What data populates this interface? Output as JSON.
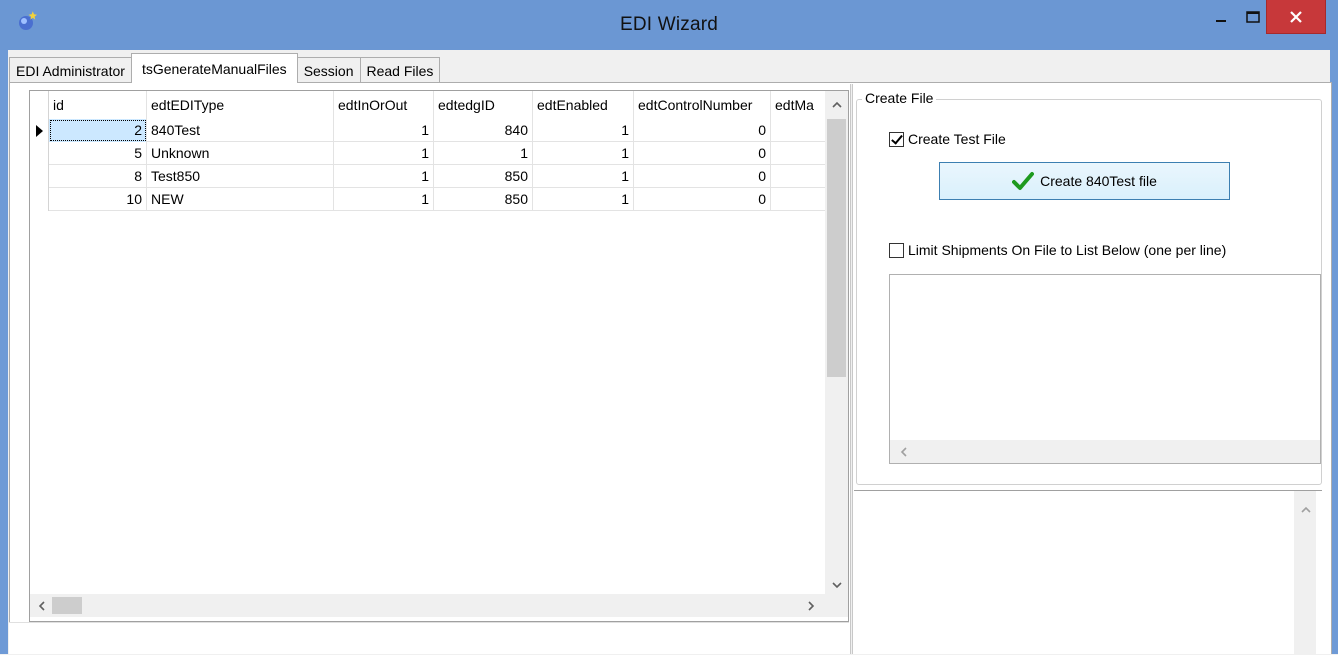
{
  "window": {
    "title": "EDI Wizard",
    "minimize_glyph": "–",
    "maximize_glyph": "☐",
    "close_glyph": "✕",
    "accent": "#6b97d3",
    "close_color": "#c7383a"
  },
  "tabs": [
    {
      "label": "EDI Administrator",
      "active": false
    },
    {
      "label": "tsGenerateManualFiles",
      "active": true
    },
    {
      "label": "Session",
      "active": false
    },
    {
      "label": "Read Files",
      "active": false
    }
  ],
  "grid": {
    "columns": [
      "id",
      "edtEDIType",
      "edtInOrOut",
      "edtedgID",
      "edtEnabled",
      "edtControlNumber",
      "edtMa"
    ],
    "rows": [
      {
        "id": "2",
        "type": "840Test",
        "inout": "1",
        "dgid": "840",
        "enabled": "1",
        "control": "0"
      },
      {
        "id": "5",
        "type": "Unknown",
        "inout": "1",
        "dgid": "1",
        "enabled": "1",
        "control": "0"
      },
      {
        "id": "8",
        "type": "Test850",
        "inout": "1",
        "dgid": "850",
        "enabled": "1",
        "control": "0"
      },
      {
        "id": "10",
        "type": "NEW",
        "inout": "1",
        "dgid": "850",
        "enabled": "1",
        "control": "0"
      }
    ]
  },
  "create_file": {
    "group_title": "Create File",
    "create_test_label": "Create Test File",
    "create_test_checked": true,
    "create_button_label": "Create 840Test file",
    "limit_label": "Limit Shipments On File to List Below (one per line)",
    "limit_checked": false
  },
  "icons": {
    "scroll_up": "^",
    "scroll_down": "v",
    "scroll_left": "<",
    "scroll_right": ">"
  }
}
